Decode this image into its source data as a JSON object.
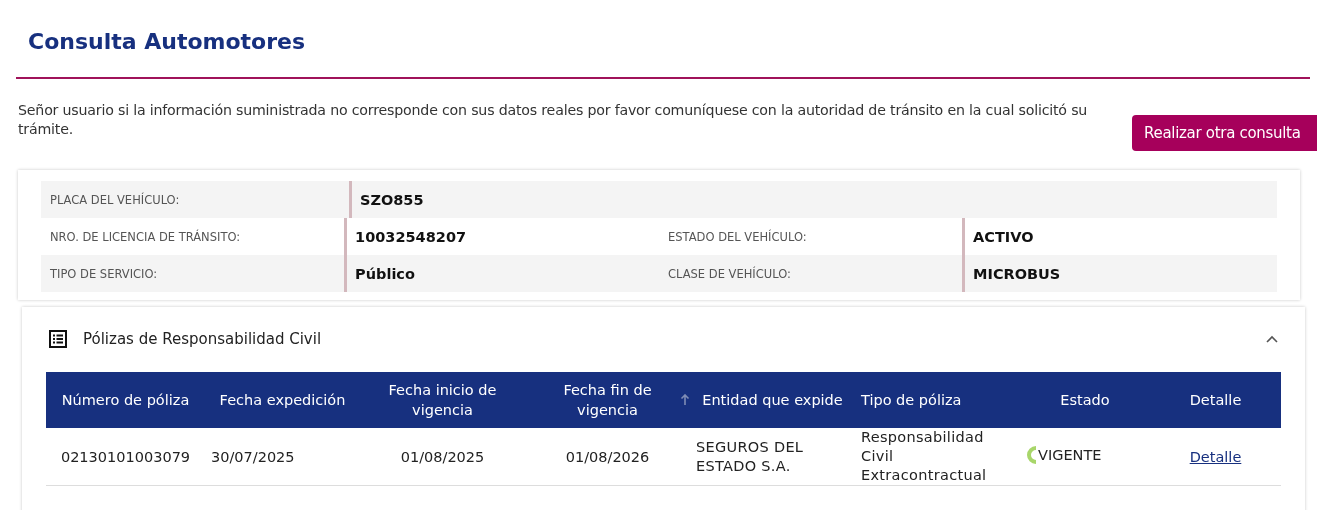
{
  "title": "Consulta Automotores",
  "notice": "Señor usuario si la información suministrada no corresponde con sus datos reales por favor comuníquese con la autoridad de tránsito en la cual solicitó su trámite.",
  "new_query_button": "Realizar otra consulta",
  "vehicle_info": [
    {
      "label": "PLACA DEL VEHÍCULO:",
      "value": "SZO855"
    },
    {
      "label": "NRO. DE LICENCIA DE TRÁNSITO:",
      "value": "10032548207",
      "label2": "ESTADO DEL VEHÍCULO:",
      "value2": "ACTIVO"
    },
    {
      "label": "TIPO DE SERVICIO:",
      "value": "Público",
      "label2": "CLASE DE VEHÍCULO:",
      "value2": "MICROBUS"
    }
  ],
  "policies": {
    "title": "Pólizas de Responsabilidad Civil",
    "expanded": true,
    "columns": [
      "Número de póliza",
      "Fecha expedición",
      "Fecha inicio de vigencia",
      "Fecha fin de vigencia",
      "Entidad que expide",
      "Tipo de póliza",
      "Estado",
      "Detalle"
    ],
    "rows": [
      {
        "number": "02130101003079",
        "issued": "30/07/2025",
        "start": "01/08/2025",
        "end": "01/08/2026",
        "insurer": "SEGUROS DEL ESTADO S.A.",
        "type": "Responsabilidad Civil Extracontractual",
        "status": "VIGENTE",
        "detail": "Detalle"
      }
    ]
  }
}
